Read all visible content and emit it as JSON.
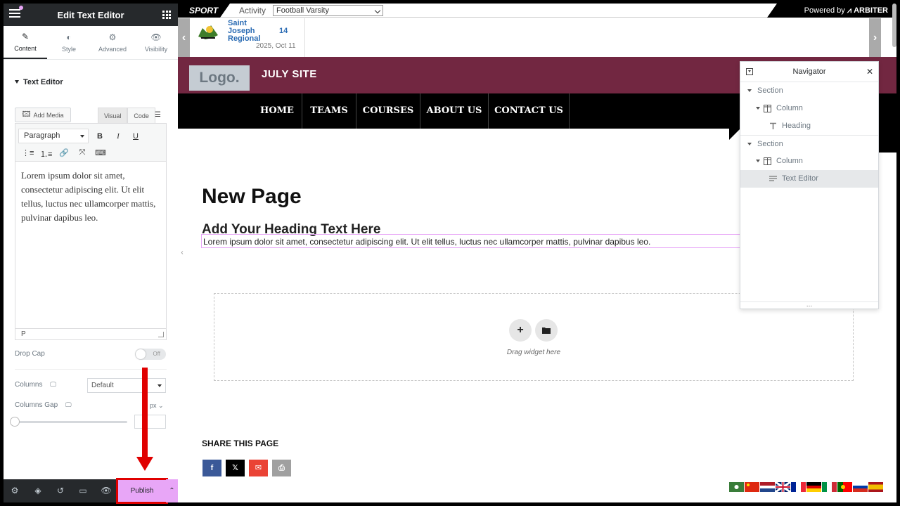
{
  "left_panel": {
    "title": "Edit Text Editor",
    "tabs": [
      {
        "label": "Content",
        "icon": "pencil-icon"
      },
      {
        "label": "Style",
        "icon": "half-circle-icon"
      },
      {
        "label": "Advanced",
        "icon": "gear-icon"
      },
      {
        "label": "Visibility",
        "icon": "eye-icon"
      }
    ],
    "section_title": "Text Editor",
    "add_media_label": "Add Media",
    "mode_tabs": [
      "Visual",
      "Code"
    ],
    "format_select": "Paragraph",
    "toolbar_bold": "B",
    "toolbar_italic": "I",
    "toolbar_underline": "U",
    "editor_text": "Lorem ipsum dolor sit amet, consectetur adipiscing elit. Ut elit tellus, luctus nec ullamcorper mattis, pulvinar dapibus leo.",
    "editor_status": "P",
    "drop_cap_label": "Drop Cap",
    "drop_cap_toggle": "Off",
    "columns_label": "Columns",
    "columns_value": "Default",
    "columns_gap_label": "Columns Gap",
    "columns_gap_unit": "px",
    "publish_label": "Publish"
  },
  "preview": {
    "sport_label": "SPORT",
    "activity_label": "Activity",
    "activity_select": "Football Varsity",
    "powered_by": "Powered by",
    "arbiter": "ARBITER",
    "game": {
      "team_line1": "Saint",
      "team_line2": "Joseph",
      "team_line3": "Regional",
      "score": "14",
      "date": "2025, Oct 11"
    },
    "logo_text": "Logo.",
    "site_title": "JULY SITE",
    "nav_items": [
      "HOME",
      "TEAMS",
      "COURSES",
      "ABOUT US",
      "CONTACT US"
    ],
    "page_title": "New Page",
    "heading": "Add Your Heading Text Here",
    "paragraph": "Lorem ipsum dolor sit amet, consectetur adipiscing elit. Ut elit tellus, luctus nec ullamcorper mattis, pulvinar dapibus leo.",
    "drop_zone_text": "Drag widget here",
    "share_title": "SHARE THIS PAGE"
  },
  "navigator": {
    "title": "Navigator",
    "tree": [
      {
        "label": "Section"
      },
      {
        "label": "Column"
      },
      {
        "label": "Heading"
      },
      {
        "label": "Section"
      },
      {
        "label": "Column"
      },
      {
        "label": "Text Editor"
      }
    ]
  },
  "colors": {
    "accent_pink": "#e8a6f7",
    "header_maroon": "#722741",
    "panel_dark": "#26292c",
    "highlight_red": "#e00000",
    "facebook": "#3b5998",
    "email": "#ea4335",
    "print": "#a0a0a0"
  }
}
